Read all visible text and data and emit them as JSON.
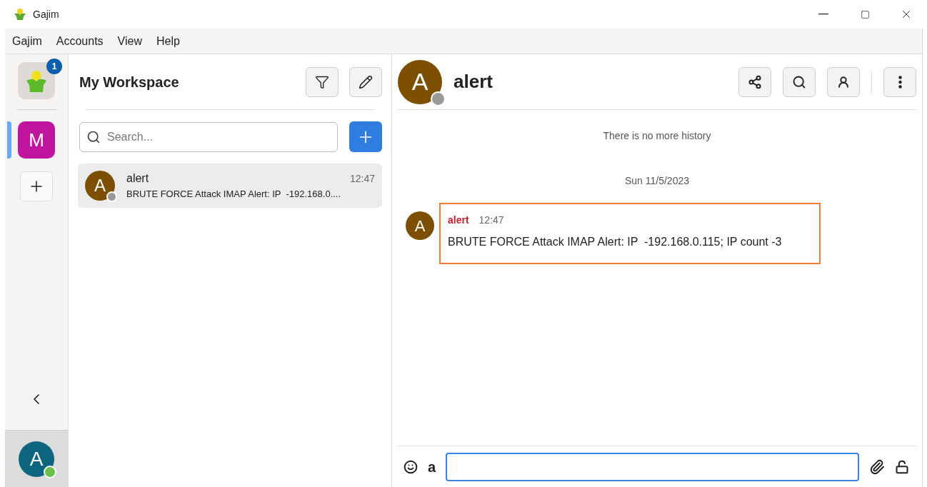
{
  "window": {
    "title": "Gajim"
  },
  "menu": [
    "Gajim",
    "Accounts",
    "View",
    "Help"
  ],
  "rail": {
    "notification_count": "1",
    "workspaces": [
      {
        "initial": "M",
        "selected": true,
        "color": "#c0149f"
      }
    ],
    "self_avatar": {
      "initial": "A",
      "online": true
    }
  },
  "chat_list": {
    "title": "My Workspace",
    "search": {
      "placeholder": "Search..."
    },
    "chats": [
      {
        "initial": "A",
        "name": "alert",
        "time": "12:47",
        "preview": "BRUTE FORCE Attack IMAP Alert: IP  -192.168.0....",
        "online": false,
        "selected": true
      }
    ]
  },
  "chat": {
    "initial": "A",
    "name": "alert",
    "online": false,
    "history_note": "There is no more history",
    "date": "Sun 11/5/2023",
    "messages": [
      {
        "initial": "A",
        "author": "alert",
        "time": "12:47",
        "text": "BRUTE FORCE Attack IMAP Alert: IP  -192.168.0.115; IP count -3",
        "highlighted": true
      }
    ],
    "composer": {
      "format_label": "a"
    }
  }
}
